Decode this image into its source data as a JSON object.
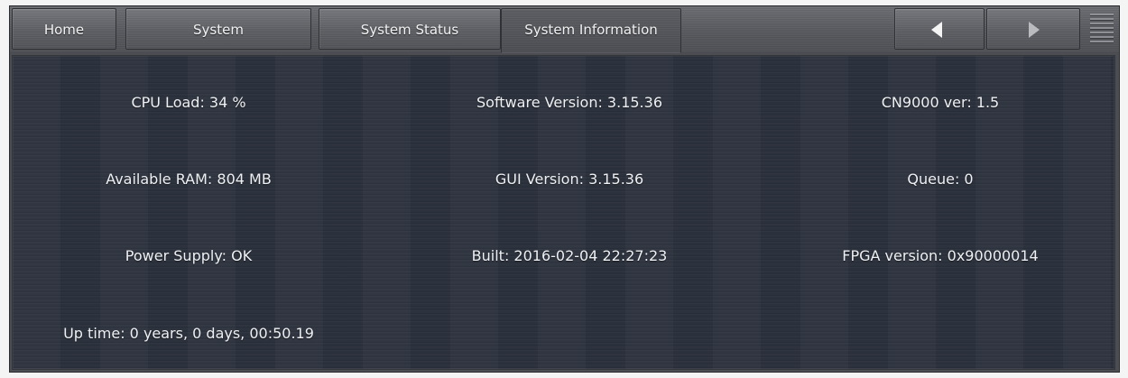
{
  "tabs": {
    "home": "Home",
    "system": "System",
    "system_status": "System Status",
    "system_information": "System Information"
  },
  "nav": {
    "prev_icon": "triangle-left-icon",
    "next_icon": "triangle-right-icon",
    "menu_icon": "hamburger-menu-icon"
  },
  "info": {
    "cpu_load": "CPU Load: 34 %",
    "software_version": "Software Version: 3.15.36",
    "cn9000_ver": "CN9000 ver: 1.5",
    "available_ram": "Available RAM: 804 MB",
    "gui_version": "GUI Version: 3.15.36",
    "queue": "Queue: 0",
    "power_supply": "Power Supply: OK",
    "built": "Built: 2016-02-04 22:27:23",
    "fpga_version": "FPGA version: 0x90000014",
    "up_time": "Up time: 0 years, 0 days, 00:50.19"
  },
  "colors": {
    "panel_bg": "#2b313c",
    "tab_bg": "#5c5e63",
    "text": "#eef0f3"
  }
}
